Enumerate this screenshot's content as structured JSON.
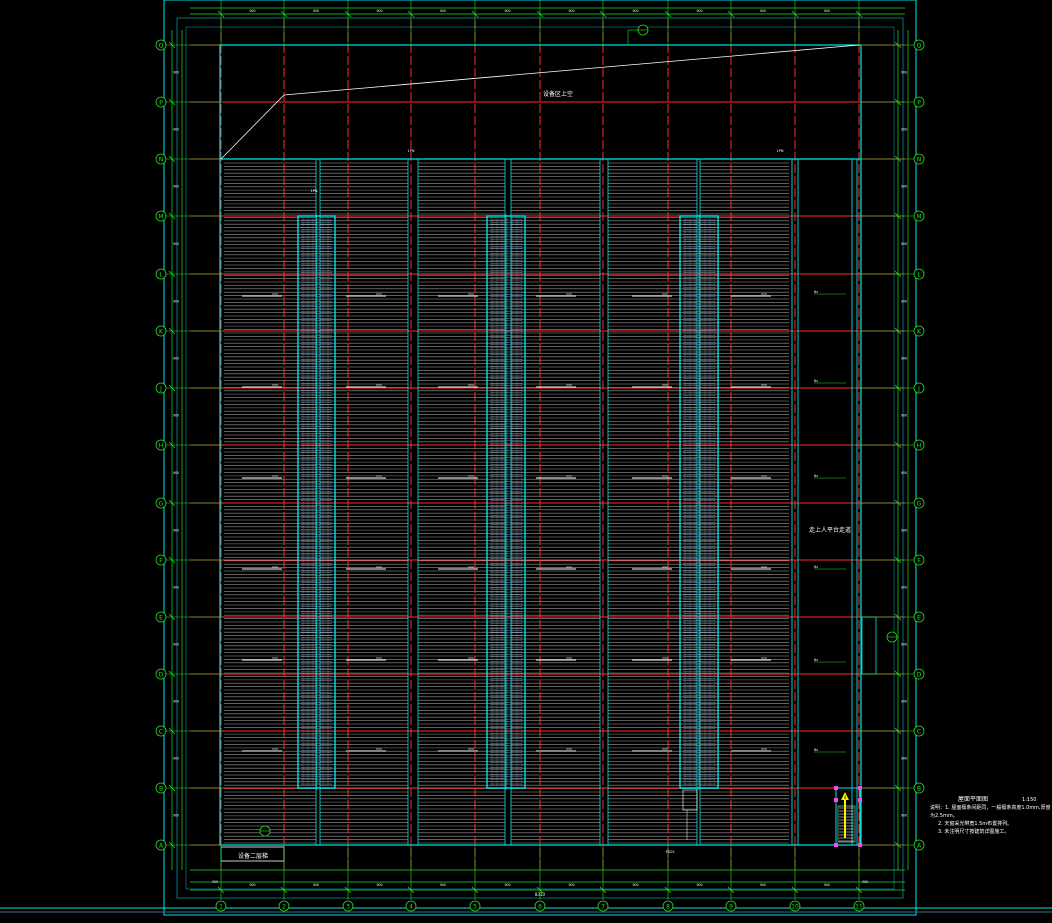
{
  "drawing": {
    "zone_top_label": "设备区上空",
    "zone_bottom_left_label": "设备二层梯",
    "right_corridor_label": "走上人平台走道",
    "stair_label": "4",
    "north_col_tag_text": "1PN",
    "south_col_tag_text": "FX2S",
    "lane_tag_text": "6s",
    "dim_small": "300",
    "dim_bay": "900",
    "dim_total": "8310",
    "grid_rows": [
      "Q",
      "P",
      "N",
      "M",
      "L",
      "K",
      "J",
      "H",
      "G",
      "F",
      "E",
      "D",
      "C",
      "B",
      "A"
    ],
    "grid_cols": [
      "1",
      "2",
      "3",
      "4",
      "5",
      "6",
      "7",
      "8",
      "9",
      "10",
      "11"
    ]
  },
  "notes": {
    "title": "屋面平面图",
    "scale": "1:150",
    "lines": [
      "说明：1. 屋面檩条间距同，一般檩条高度1.0mm,厚度为2.5mm。",
      "2. 天窗采光带宽1.5m布置排列。",
      "3. 未注明尺寸按建筑详图施工。"
    ]
  },
  "colors": {
    "cyan": "#00e5e5",
    "red": "#ff2a2a",
    "green": "#22dd22",
    "white": "#ffffff",
    "stripe": "#9a9a9a",
    "magenta": "#ff44ff",
    "yellow": "#f2f200"
  }
}
